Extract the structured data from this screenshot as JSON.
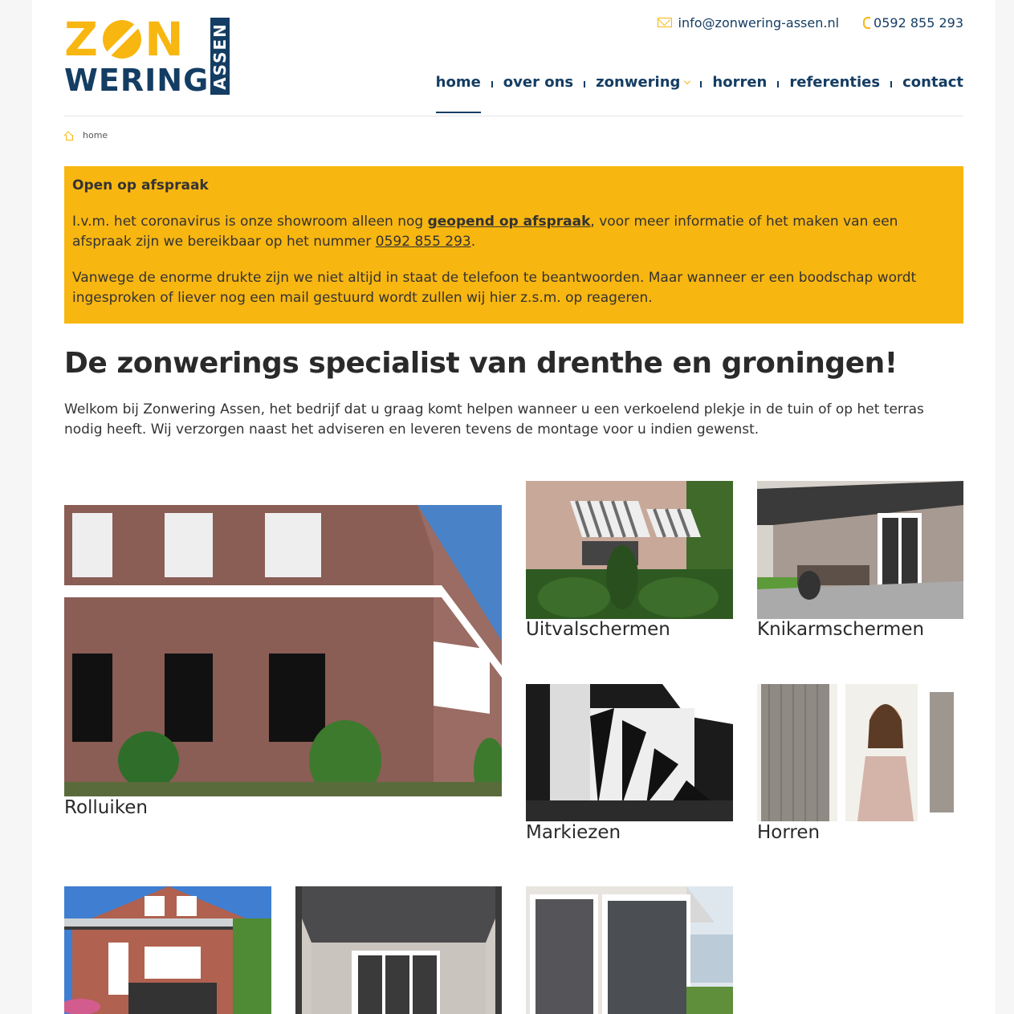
{
  "header": {
    "logo": {
      "zon": "ZON",
      "wering": "WERING",
      "assen": "ASSEN"
    },
    "email": "info@zonwering-assen.nl",
    "phone": "0592 855 293"
  },
  "nav": {
    "items": [
      {
        "label": "home"
      },
      {
        "label": "over ons"
      },
      {
        "label": "zonwering"
      },
      {
        "label": "horren"
      },
      {
        "label": "referenties"
      },
      {
        "label": "contact"
      }
    ]
  },
  "breadcrumb": {
    "home": "home"
  },
  "notice": {
    "title": "Open op afspraak",
    "p1_a": "I.v.m. het coronavirus is onze showroom alleen nog ",
    "p1_link": "geopend op afspraak",
    "p1_b": ", voor meer informatie of het maken van een afspraak zijn we bereikbaar op het nummer ",
    "p1_phone": "0592 855 293",
    "p1_c": ".",
    "p2": "Vanwege de enorme drukte zijn we niet altijd in staat de telefoon te beantwoorden. Maar wanneer er een boodschap wordt ingesproken of liever nog een mail gestuurd wordt zullen wij hier z.s.m. op reageren."
  },
  "main": {
    "headline": "De zonwerings specialist van drenthe en groningen!",
    "intro": "Welkom bij Zonwering Assen, het bedrijf dat u graag komt helpen wanneer u een verkoelend plekje in de tuin of op het terras nodig heeft. Wij verzorgen naast het adviseren en leveren tevens de montage voor u indien gewenst."
  },
  "products": [
    {
      "label": "Rolluiken"
    },
    {
      "label": "Uitvalschermen"
    },
    {
      "label": "Knikarmschermen"
    },
    {
      "label": "Markiezen"
    },
    {
      "label": "Horren"
    },
    {
      "label": ""
    },
    {
      "label": ""
    },
    {
      "label": ""
    }
  ],
  "colors": {
    "brand_yellow": "#f8b611",
    "brand_blue": "#143d63"
  }
}
